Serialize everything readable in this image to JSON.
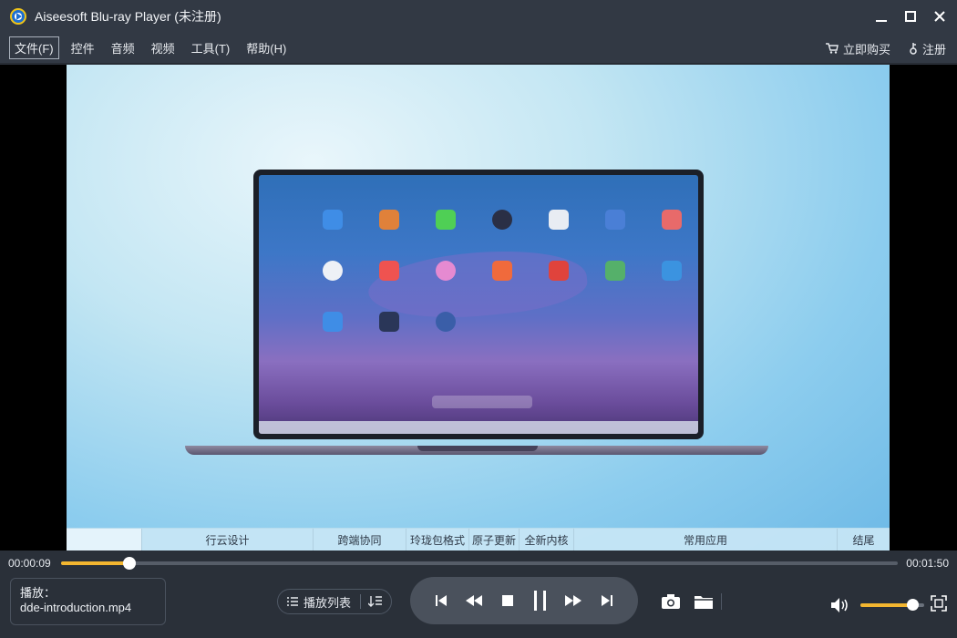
{
  "window": {
    "title": "Aiseesoft Blu-ray Player (未注册)"
  },
  "menu": {
    "items": [
      {
        "label": "文件(F)"
      },
      {
        "label": "控件"
      },
      {
        "label": "音频"
      },
      {
        "label": "视频"
      },
      {
        "label": "工具(T)"
      },
      {
        "label": "帮助(H)"
      }
    ],
    "buy_label": "立即购买",
    "register_label": "注册"
  },
  "chapters": [
    {
      "label": ""
    },
    {
      "label": "行云设计"
    },
    {
      "label": "跨端协同"
    },
    {
      "label": "玲珑包格式"
    },
    {
      "label": "原子更新"
    },
    {
      "label": "全新内核"
    },
    {
      "label": "常用应用"
    },
    {
      "label": "结尾"
    }
  ],
  "playback": {
    "current_time": "00:00:09",
    "total_time": "00:01:50",
    "progress_fraction": 0.082
  },
  "now_playing": {
    "label": "播放：",
    "file": "dde-introduction.mp4"
  },
  "playlist": {
    "label": "播放列表"
  },
  "volume": {
    "level_fraction": 0.81
  },
  "colors": {
    "accent": "#f3b630",
    "titlebar_bg": "#323944",
    "panel_bg": "#2a3039"
  },
  "icons": {
    "camera": "camera-icon",
    "folder": "folder-icon",
    "speaker": "speaker-icon",
    "fullscreen": "fullscreen-icon"
  }
}
